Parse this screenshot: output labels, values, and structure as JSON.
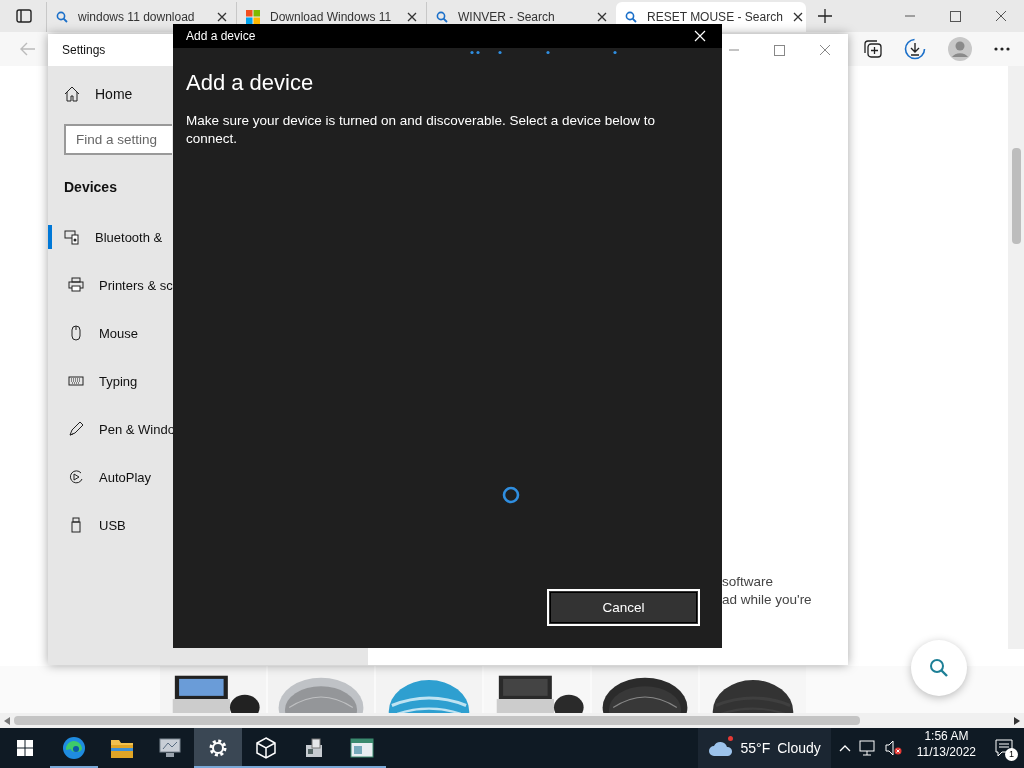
{
  "browser": {
    "tabs": [
      {
        "title": "windows 11 download",
        "selected": false
      },
      {
        "title": "Download Windows 11",
        "selected": false
      },
      {
        "title": "WINVER - Search",
        "selected": false
      },
      {
        "title": "RESET MOUSE - Search",
        "selected": true
      }
    ]
  },
  "settings_window": {
    "title": "Settings",
    "home": "Home",
    "search": {
      "placeholder": "Find a setting"
    },
    "section": "Devices",
    "nav": [
      {
        "label": "Bluetooth &",
        "selected": true
      },
      {
        "label": "Printers & sc",
        "selected": false
      },
      {
        "label": "Mouse",
        "selected": false
      },
      {
        "label": "Typing",
        "selected": false
      },
      {
        "label": "Pen & Windo",
        "selected": false
      },
      {
        "label": "AutoPlay",
        "selected": false
      },
      {
        "label": "USB",
        "selected": false
      }
    ],
    "content_lines": [
      "software",
      "ad while you're"
    ]
  },
  "dialog": {
    "title": "Add a device",
    "heading": "Add a device",
    "message": "Make sure your device is turned on and discoverable. Select a device below to connect.",
    "button": "Cancel"
  },
  "taskbar": {
    "apps": [
      {
        "running": true,
        "selected": false
      },
      {
        "running": false,
        "selected": false
      },
      {
        "running": false,
        "selected": false
      },
      {
        "running": true,
        "selected": true
      },
      {
        "running": true,
        "selected": false
      },
      {
        "running": true,
        "selected": false
      },
      {
        "running": true,
        "selected": false
      }
    ],
    "weather": {
      "temperature": "55°F",
      "condition": "Cloudy"
    },
    "clock": {
      "time": "1:56 AM",
      "date": "11/13/2022"
    },
    "notifications": {
      "count": "1"
    }
  }
}
